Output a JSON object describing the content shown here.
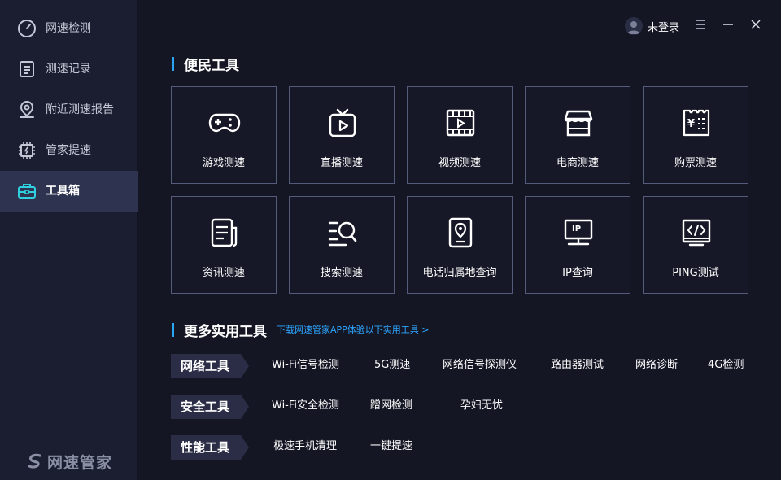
{
  "sidebar": {
    "items": [
      {
        "label": "网速检测",
        "icon": "speedometer-icon"
      },
      {
        "label": "测速记录",
        "icon": "document-list-icon"
      },
      {
        "label": "附近测速报告",
        "icon": "location-pin-icon"
      },
      {
        "label": "管家提速",
        "icon": "chip-boost-icon"
      },
      {
        "label": "工具箱",
        "icon": "toolbox-icon",
        "active": true
      }
    ],
    "brand": "网速管家"
  },
  "topbar": {
    "user_label": "未登录"
  },
  "convenience": {
    "title": "便民工具",
    "tiles": [
      {
        "label": "游戏测速",
        "icon": "gamepad-icon"
      },
      {
        "label": "直播测速",
        "icon": "tv-live-icon"
      },
      {
        "label": "视频测速",
        "icon": "video-film-icon"
      },
      {
        "label": "电商测速",
        "icon": "shop-store-icon"
      },
      {
        "label": "购票测速",
        "icon": "ticket-icon"
      },
      {
        "label": "资讯测速",
        "icon": "news-icon"
      },
      {
        "label": "搜索测速",
        "icon": "search-list-icon"
      },
      {
        "label": "电话归属地查询",
        "icon": "phone-location-icon"
      },
      {
        "label": "IP查询",
        "icon": "ip-monitor-icon"
      },
      {
        "label": "PING测试",
        "icon": "code-monitor-icon"
      }
    ]
  },
  "more": {
    "title": "更多实用工具",
    "link": "下载网速管家APP体验以下实用工具 >",
    "groups": [
      {
        "name": "网络工具",
        "tools": [
          "Wi-Fi信号检测",
          "5G测速",
          "网络信号探测仪",
          "路由器测试",
          "网络诊断",
          "4G检测"
        ]
      },
      {
        "name": "安全工具",
        "tools": [
          "Wi-Fi安全检测",
          "蹭网检测",
          "孕妇无忧"
        ]
      },
      {
        "name": "性能工具",
        "tools": [
          "极速手机清理",
          "一键提速"
        ]
      }
    ]
  },
  "colors": {
    "accent": "#29a6f2",
    "link": "#2ea5ff",
    "active_nav": "#2e3450",
    "toolbox_icon": "#2fd0e0"
  }
}
